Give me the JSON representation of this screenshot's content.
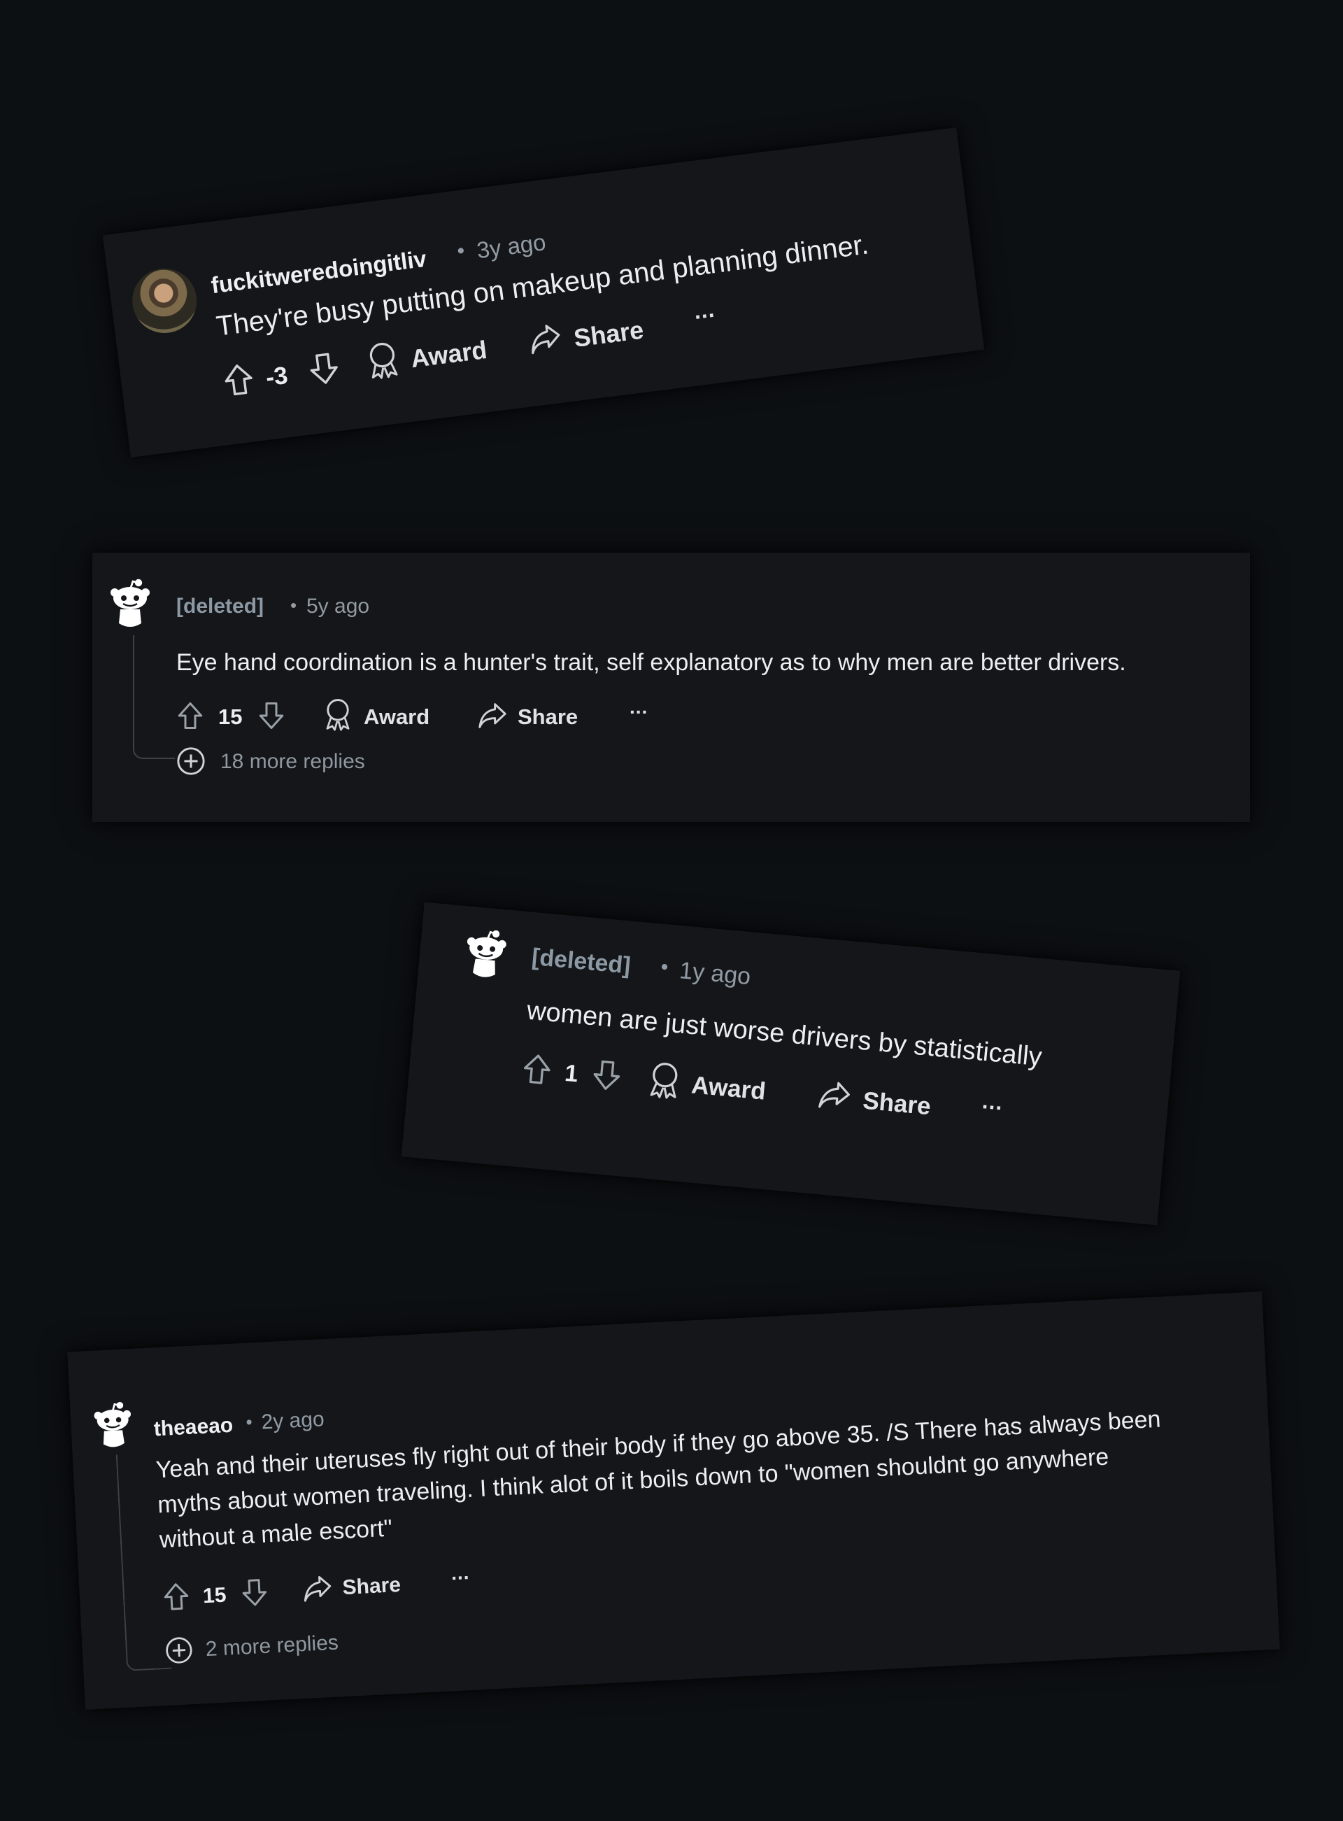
{
  "comments": [
    {
      "username": "fuckitweredoingitliv",
      "separator": "•",
      "time": "3y ago",
      "text": "They're busy putting on makeup and planning dinner.",
      "score": "-3",
      "award_label": "Award",
      "share_label": "Share",
      "more_label": "..."
    },
    {
      "username": "[deleted]",
      "separator": "•",
      "time": "5y ago",
      "text": "Eye hand coordination is a hunter's trait, self explanatory as to why men are better drivers.",
      "score": "15",
      "award_label": "Award",
      "share_label": "Share",
      "more_label": "...",
      "replies_label": "18 more replies"
    },
    {
      "username": "[deleted]",
      "separator": "•",
      "time": "1y ago",
      "text": "women are just worse drivers by statistically",
      "score": "1",
      "award_label": "Award",
      "share_label": "Share",
      "more_label": "..."
    },
    {
      "username": "theaeao",
      "separator": "•",
      "time": "2y ago",
      "text_lines": [
        "Yeah and their uteruses fly right out of their body if they go above 35. /S There has always been",
        "myths about women traveling. I think alot of it boils down to \"women shouldnt go anywhere",
        "without a male escort\""
      ],
      "score": "15",
      "share_label": "Share",
      "more_label": "...",
      "replies_label": "2 more replies"
    }
  ]
}
